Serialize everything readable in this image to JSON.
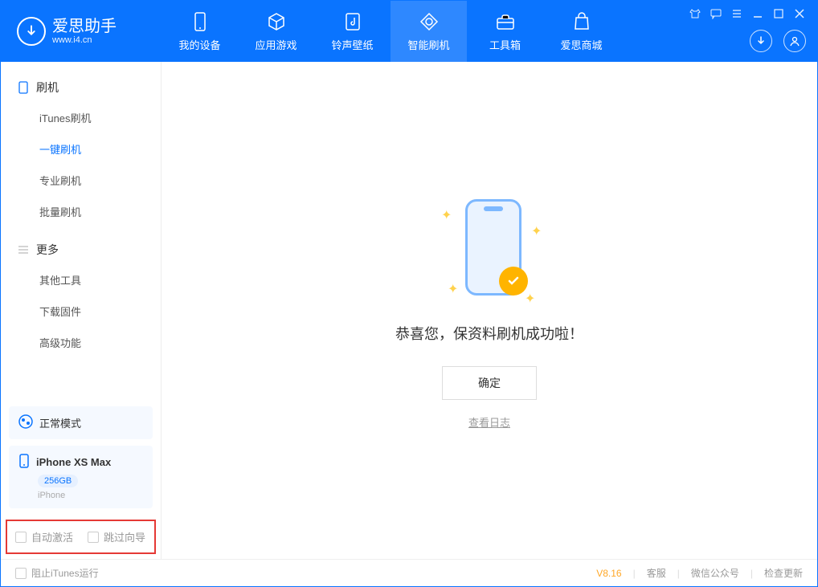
{
  "app": {
    "name": "爱思助手",
    "domain": "www.i4.cn"
  },
  "tabs": [
    {
      "label": "我的设备",
      "icon": "device-icon"
    },
    {
      "label": "应用游戏",
      "icon": "cube-icon"
    },
    {
      "label": "铃声壁纸",
      "icon": "music-icon"
    },
    {
      "label": "智能刷机",
      "icon": "refresh-icon",
      "active": true
    },
    {
      "label": "工具箱",
      "icon": "toolbox-icon"
    },
    {
      "label": "爱思商城",
      "icon": "bag-icon"
    }
  ],
  "sidebar": {
    "group1": {
      "title": "刷机",
      "items": [
        "iTunes刷机",
        "一键刷机",
        "专业刷机",
        "批量刷机"
      ],
      "active_index": 1
    },
    "group2": {
      "title": "更多",
      "items": [
        "其他工具",
        "下载固件",
        "高级功能"
      ]
    }
  },
  "mode": {
    "label": "正常模式"
  },
  "device": {
    "name": "iPhone XS Max",
    "storage": "256GB",
    "type": "iPhone"
  },
  "checks": {
    "auto_activate": "自动激活",
    "skip_guide": "跳过向导"
  },
  "main": {
    "success_text": "恭喜您，保资料刷机成功啦！",
    "ok_button": "确定",
    "view_log": "查看日志"
  },
  "statusbar": {
    "block_itunes": "阻止iTunes运行",
    "version": "V8.16",
    "links": [
      "客服",
      "微信公众号",
      "检查更新"
    ]
  }
}
